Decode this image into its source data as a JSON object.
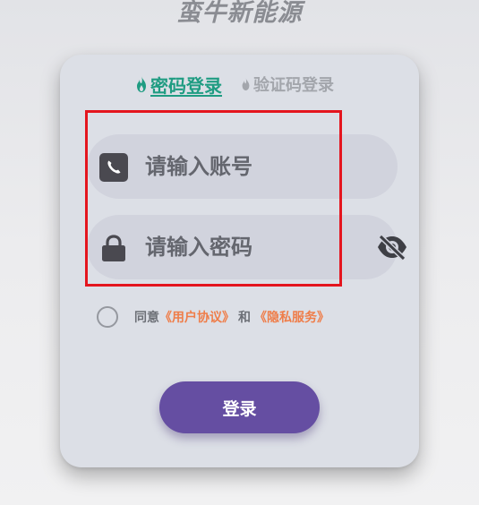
{
  "app": {
    "title": "蛮牛新能源"
  },
  "tabs": {
    "password_login": "密码登录",
    "code_login": "验证码登录"
  },
  "form": {
    "account_placeholder": "请输入账号",
    "password_placeholder": "请输入密码"
  },
  "agreement": {
    "prefix": "同意",
    "user_agreement": "《用户协议》",
    "joiner": "和",
    "privacy": "《隐私服务》",
    "checked": false
  },
  "actions": {
    "login_label": "登录"
  },
  "icons": {
    "active_tab": "flame-icon",
    "inactive_tab": "flame-icon",
    "account": "phone-icon",
    "password": "lock-icon",
    "visibility": "eye-off-icon"
  },
  "colors": {
    "accent_tab": "#1f9c82",
    "link": "#ef7d49",
    "button": "#654ea2",
    "highlight": "#e4151e"
  }
}
